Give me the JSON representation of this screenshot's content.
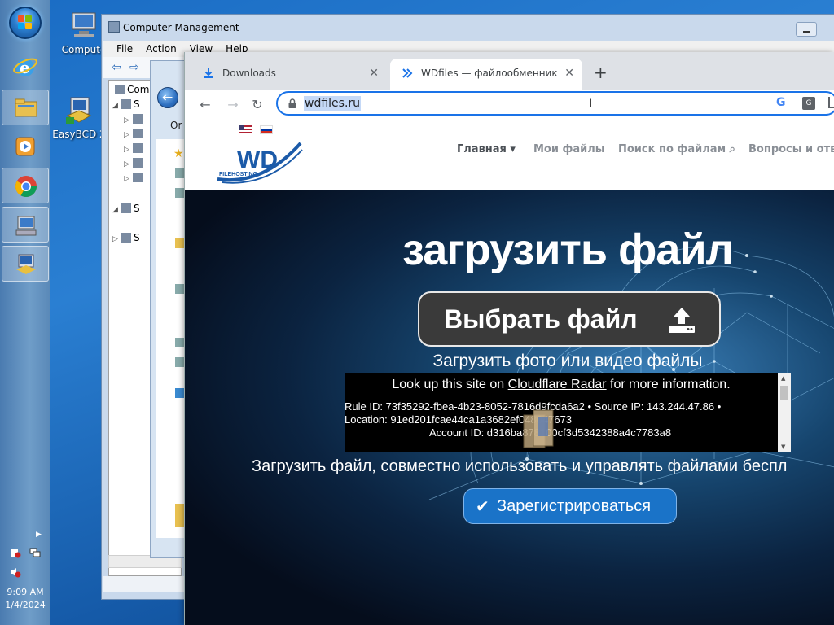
{
  "taskbar": {
    "clock_time": "9:09 AM",
    "clock_date": "1/4/2024"
  },
  "desktop_icons": [
    {
      "label": "Compute"
    },
    {
      "label": "EasyBCD 2"
    }
  ],
  "computer_management": {
    "title": "Computer Management",
    "menu": [
      "File",
      "Action",
      "View",
      "Help"
    ],
    "tree": [
      {
        "label": "Comp"
      },
      {
        "label": "S"
      },
      {
        "label": "S"
      },
      {
        "label": "S"
      }
    ]
  },
  "explorer": {
    "organize_label": "Or"
  },
  "chrome": {
    "tabs": [
      {
        "label": "Downloads",
        "close": "✕"
      },
      {
        "label": "WDfiles — файлообменник бесп",
        "close": "✕"
      }
    ],
    "new_tab": "+",
    "address": "wdfiles.ru"
  },
  "site": {
    "nav": [
      {
        "label": "Главная ▾"
      },
      {
        "label": "Мои файлы"
      },
      {
        "label": "Поиск по файлам"
      },
      {
        "label": "Вопросы и отве"
      }
    ],
    "logo_text": "WD",
    "logo_sub": "FILEHOSTING",
    "hero_title": "загрузить файл",
    "upload_button": "Выбрать файл",
    "upload_subtitle": "Загрузить фото или видео файлы",
    "cloudflare": {
      "line1_prefix": "Look up this site on ",
      "line1_link": "Cloudflare Radar",
      "line1_suffix": " for more information.",
      "line2": "Rule ID: 73f35292-fbea-4b23-8052-7816d9fcda6a2 • Source IP: 143.244.47.86 •",
      "line2b": "Location: 91ed201fcae44ca1a3682ef048047673",
      "line3": "Account ID: d316ba878100cf3d5342388a4c7783a8"
    },
    "tagline": "Загрузить файл, совместно использовать и управлять файлами беспл",
    "register_button": "Зарегистрироваться"
  },
  "colors": {
    "chrome_focus": "#1a73e8",
    "register_blue": "#1a73c8",
    "desktop_blue": "#1e5fa8"
  }
}
